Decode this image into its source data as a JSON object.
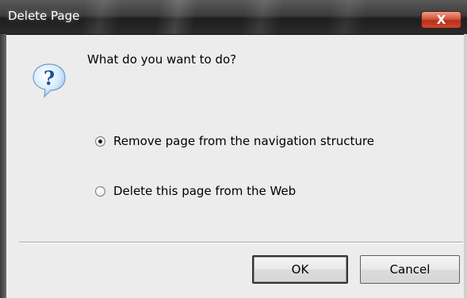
{
  "window": {
    "title": "Delete Page",
    "close_label": "X"
  },
  "dialog": {
    "icon": "question-icon",
    "prompt": "What do you want to do?",
    "options": [
      {
        "label": "Remove page from the navigation structure",
        "selected": true
      },
      {
        "label": "Delete this page from the Web",
        "selected": false
      }
    ],
    "buttons": {
      "ok": "OK",
      "cancel": "Cancel"
    }
  },
  "colors": {
    "client_background": "#ececec",
    "titlebar": "#2a2a2a",
    "close_button": "#c94a30",
    "icon_bubble": "#cfe6fb",
    "icon_mark": "#1b4e9a"
  }
}
